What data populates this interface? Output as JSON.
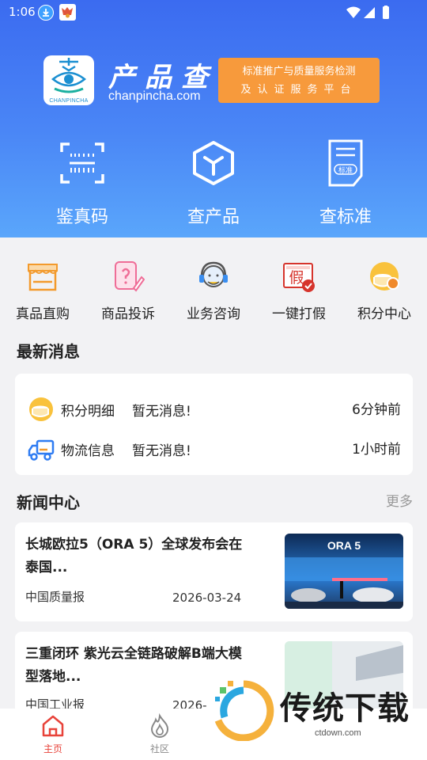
{
  "status_bar": {
    "time": "1:06"
  },
  "brand": {
    "name_cn": "产品查",
    "domain": "chanpincha.com",
    "logo_caption": "CHANPINCHA",
    "slogan_line1": "标准推广与质量服务检测",
    "slogan_line2": "及认证服务平台"
  },
  "hero_tools": [
    {
      "label": "鉴真码",
      "icon": "scan-code-icon"
    },
    {
      "label": "查产品",
      "icon": "product-box-icon"
    },
    {
      "label": "查标准",
      "icon": "standard-document-icon",
      "badge": "标准"
    }
  ],
  "quick_menu": [
    {
      "label": "真品直购",
      "icon": "shop-icon"
    },
    {
      "label": "商品投诉",
      "icon": "complaint-icon"
    },
    {
      "label": "业务咨询",
      "icon": "customer-service-icon"
    },
    {
      "label": "一键打假",
      "icon": "anti-fake-icon",
      "glyph": "假"
    },
    {
      "label": "积分中心",
      "icon": "points-icon"
    }
  ],
  "messages": {
    "title": "最新消息",
    "items": [
      {
        "name": "积分明细",
        "text": "暂无消息!",
        "time": "6分钟前",
        "icon": "points-coin-icon"
      },
      {
        "name": "物流信息",
        "text": "暂无消息!",
        "time": "1小时前",
        "icon": "truck-icon"
      }
    ]
  },
  "news": {
    "title": "新闻中心",
    "more": "更多",
    "items": [
      {
        "title": "长城欧拉5（ORA 5）全球发布会在泰国...",
        "source": "中国质量报",
        "date": "2026-03-24",
        "image_text": "ORA 5"
      },
      {
        "title": "三重闭环 紫光云全链路破解B端大模型落地...",
        "source": "中国工业报",
        "date": "2026-"
      }
    ]
  },
  "tabbar": [
    {
      "label": "主页",
      "icon": "home-icon",
      "active": true
    },
    {
      "label": "社区",
      "icon": "community-flame-icon",
      "active": false
    }
  ],
  "watermark": {
    "text": "传统下载",
    "url": "ctdown.com"
  },
  "colors": {
    "accent": "#e8433a",
    "hero": "#4a86f6",
    "orange": "#f79a3c"
  }
}
